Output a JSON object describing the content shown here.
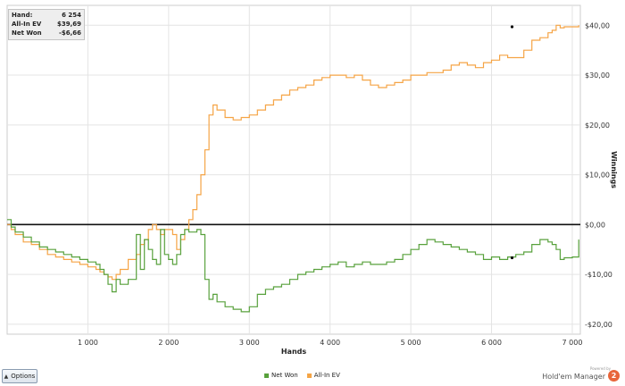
{
  "info": {
    "hand_label": "Hand:",
    "hand_value": "6 254",
    "allin_label": "All-In EV",
    "allin_value": "$39,69",
    "netwon_label": "Net Won",
    "netwon_value": "-$6,66"
  },
  "bottom": {
    "options_label": "Options",
    "legend_net_won": "Net Won",
    "legend_allin_ev": "All-In EV",
    "brand_powered": "Powered by",
    "brand_name": "Hold'em Manager",
    "brand_logo": "2"
  },
  "colors": {
    "net_won": "#58a13c",
    "allin_ev": "#f5a445",
    "grid": "#e4e4e4",
    "zero_line": "#111111",
    "logo": "#e8653a"
  },
  "chart_data": {
    "type": "line",
    "xlabel": "Hands",
    "ylabel": "Winnings",
    "xlim": [
      0,
      7100
    ],
    "ylim": [
      -22,
      44
    ],
    "x_ticks": [
      1000,
      2000,
      3000,
      4000,
      5000,
      6000,
      7000
    ],
    "x_tick_labels": [
      "1 000",
      "2 000",
      "3 000",
      "4 000",
      "5 000",
      "6 000",
      "7 000"
    ],
    "y_ticks": [
      -20,
      -10,
      0,
      10,
      20,
      30,
      40
    ],
    "y_tick_labels": [
      "-$20,00",
      "-$10,00",
      "$0,00",
      "$10,00",
      "$20,00",
      "$30,00",
      "$40,00"
    ],
    "grid": true,
    "legend_position": "bottom",
    "marker": {
      "hand": 6254,
      "allin_ev": 39.69,
      "net_won": -6.66
    },
    "series": [
      {
        "name": "All-In EV",
        "x": [
          0,
          50,
          100,
          200,
          300,
          400,
          500,
          600,
          700,
          800,
          900,
          1000,
          1100,
          1150,
          1200,
          1250,
          1300,
          1350,
          1400,
          1500,
          1600,
          1650,
          1700,
          1750,
          1800,
          1850,
          1900,
          1950,
          2000,
          2050,
          2100,
          2150,
          2200,
          2250,
          2300,
          2350,
          2400,
          2450,
          2500,
          2550,
          2600,
          2700,
          2800,
          2900,
          3000,
          3100,
          3200,
          3300,
          3400,
          3500,
          3600,
          3700,
          3800,
          3900,
          4000,
          4100,
          4200,
          4300,
          4400,
          4500,
          4600,
          4700,
          4800,
          4900,
          5000,
          5100,
          5200,
          5300,
          5400,
          5500,
          5600,
          5700,
          5800,
          5900,
          6000,
          6100,
          6200,
          6300,
          6400,
          6500,
          6600,
          6700,
          6750,
          6800,
          6850,
          6900,
          7000,
          7080
        ],
        "y": [
          0,
          -1,
          -2,
          -3.5,
          -4,
          -5,
          -6,
          -6.5,
          -7,
          -7.5,
          -8,
          -8.5,
          -9,
          -9.5,
          -10,
          -10.5,
          -11,
          -10,
          -9,
          -7,
          -6,
          -4,
          -3,
          -1,
          0,
          -1,
          -2,
          -1,
          -1,
          -2,
          -5,
          -3,
          -1,
          1,
          3,
          6,
          10,
          15,
          22,
          24,
          23,
          21.5,
          21,
          21.5,
          22,
          23,
          24,
          25,
          26,
          27,
          27.5,
          28,
          29,
          29.5,
          30,
          30,
          29.5,
          30,
          29,
          28,
          27.5,
          28,
          28.5,
          29,
          30,
          30,
          30.5,
          30.5,
          31,
          32,
          32.5,
          32,
          31.5,
          32.5,
          33,
          34,
          33.5,
          33.5,
          35,
          37,
          37.5,
          38.5,
          39,
          40,
          39.5,
          39.7,
          39.7,
          40
        ]
      },
      {
        "name": "Net Won",
        "x": [
          0,
          50,
          100,
          200,
          300,
          400,
          500,
          600,
          700,
          800,
          900,
          1000,
          1100,
          1150,
          1200,
          1250,
          1300,
          1350,
          1400,
          1500,
          1600,
          1650,
          1700,
          1750,
          1800,
          1850,
          1900,
          1950,
          2000,
          2050,
          2100,
          2150,
          2200,
          2250,
          2300,
          2350,
          2400,
          2450,
          2500,
          2550,
          2600,
          2700,
          2800,
          2900,
          3000,
          3100,
          3200,
          3300,
          3400,
          3500,
          3600,
          3700,
          3800,
          3900,
          4000,
          4100,
          4200,
          4300,
          4400,
          4500,
          4600,
          4700,
          4800,
          4900,
          5000,
          5100,
          5200,
          5300,
          5400,
          5500,
          5600,
          5700,
          5800,
          5900,
          6000,
          6100,
          6200,
          6300,
          6400,
          6500,
          6600,
          6700,
          6750,
          6800,
          6850,
          6900,
          7000,
          7080
        ],
        "y": [
          1,
          -0.5,
          -1.5,
          -2.5,
          -3.5,
          -4.5,
          -5,
          -5.5,
          -6,
          -6.5,
          -7,
          -7.5,
          -8,
          -9,
          -10,
          -12,
          -13.5,
          -11,
          -12,
          -11,
          -2,
          -9,
          -3,
          -5,
          -7,
          -8,
          -1,
          -6,
          -7,
          -8,
          -6,
          -2,
          -1,
          -1.5,
          -1.5,
          -1,
          -2,
          -11,
          -15,
          -14,
          -15.5,
          -16.5,
          -17,
          -17.5,
          -16.5,
          -14,
          -13,
          -12.5,
          -12,
          -11,
          -10,
          -9.5,
          -9,
          -8.5,
          -8,
          -7.5,
          -8.5,
          -8,
          -7.5,
          -8,
          -8,
          -7.5,
          -7,
          -6,
          -5,
          -4,
          -3,
          -3.5,
          -4,
          -4.5,
          -5,
          -5.5,
          -6,
          -7,
          -6.5,
          -7,
          -6.5,
          -6,
          -5.5,
          -4,
          -3,
          -3.5,
          -4,
          -5,
          -7,
          -6.66,
          -6.5,
          -3
        ]
      }
    ]
  }
}
